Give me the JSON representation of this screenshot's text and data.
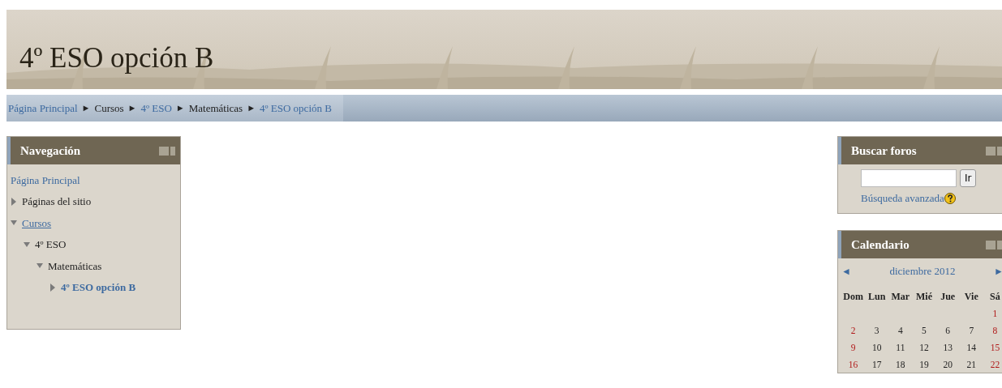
{
  "header": {
    "title": "4º ESO opción B",
    "kind": "picture"
  },
  "breadcrumb": [
    {
      "label": "Página Principal",
      "link": true
    },
    {
      "separator": "►",
      "label": "Cursos",
      "link": false
    },
    {
      "separator": "►",
      "label": "4º ESO",
      "link": true
    },
    {
      "separator": "►",
      "label": "Matemáticas",
      "link": false
    },
    {
      "separator": "►",
      "label": "4º ESO opción B",
      "link": true
    }
  ],
  "navigation": {
    "title": "Navegación",
    "items": [
      {
        "label": "Página Principal",
        "link": true
      },
      {
        "label": "Páginas del sitio",
        "link": false,
        "expanded": false
      },
      {
        "label": "Cursos",
        "link": true,
        "expanded": true,
        "children": [
          {
            "label": "4º ESO",
            "link": false,
            "expanded": true,
            "children": [
              {
                "label": "Matemáticas",
                "link": false,
                "expanded": true,
                "children": [
                  {
                    "label": "4º ESO opción B",
                    "link": true,
                    "current": true,
                    "expanded": false
                  }
                ]
              }
            ]
          }
        ]
      }
    ]
  },
  "forum_search": {
    "title": "Buscar foros",
    "button": "Ir",
    "advanced": "Búsqueda avanzada"
  },
  "calendar": {
    "title": "Calendario",
    "month": "diciembre 2012",
    "prev": "◄",
    "next": "►",
    "weekdays": [
      "Dom",
      "Lun",
      "Mar",
      "Mié",
      "Jue",
      "Vie",
      "Sá"
    ],
    "weeks": [
      [
        {
          "day": "1",
          "weekend": true
        }
      ],
      [
        {
          "day": "2",
          "weekend": true
        },
        {
          "day": "3",
          "weekend": false
        },
        {
          "day": "4",
          "weekend": false
        },
        {
          "day": "5",
          "weekend": false
        },
        {
          "day": "6",
          "weekend": false
        },
        {
          "day": "7",
          "weekend": false
        },
        {
          "day": "8",
          "weekend": true
        }
      ],
      [
        {
          "day": "9",
          "weekend": true
        },
        {
          "day": "10",
          "weekend": false
        },
        {
          "day": "11",
          "weekend": false
        },
        {
          "day": "12",
          "weekend": false
        },
        {
          "day": "13",
          "weekend": false
        },
        {
          "day": "14",
          "weekend": false
        },
        {
          "day": "15",
          "weekend": true
        }
      ],
      [
        {
          "day": "16",
          "weekend": true
        },
        {
          "day": "17",
          "weekend": false
        },
        {
          "day": "18",
          "weekend": false
        },
        {
          "day": "19",
          "weekend": false
        },
        {
          "day": "20",
          "weekend": false
        },
        {
          "day": "21",
          "weekend": false
        },
        {
          "day": "22",
          "weekend": true
        }
      ]
    ]
  }
}
